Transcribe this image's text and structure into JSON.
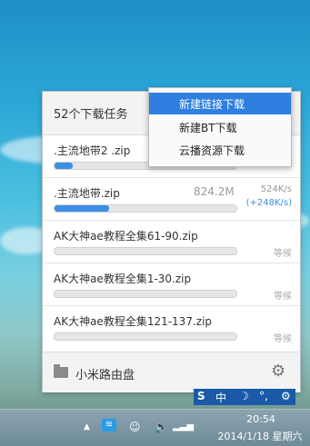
{
  "panel": {
    "title": "52个下载任务",
    "footer_label": "小米路由盘"
  },
  "menu": {
    "items": [
      {
        "label": "新建链接下载",
        "active": true
      },
      {
        "label": "新建BT下载",
        "active": false
      },
      {
        "label": "云播资源下载",
        "active": false
      }
    ]
  },
  "downloads": [
    {
      "name": ".主流地带2 .zip",
      "size": "",
      "speed": "",
      "speed_up": "",
      "status": "",
      "progress": 0.1
    },
    {
      "name": ".主流地带.zip",
      "size": "824.2M",
      "speed": "524K/s",
      "speed_up": "(+248K/s)",
      "status": "",
      "progress": 0.3
    },
    {
      "name": "AK大神ae教程全集61-90.zip",
      "size": "",
      "speed": "",
      "speed_up": "",
      "status": "等候",
      "progress": 0
    },
    {
      "name": "AK大神ae教程全集1-30.zip",
      "size": "",
      "speed": "",
      "speed_up": "",
      "status": "等候",
      "progress": 0
    },
    {
      "name": "AK大神ae教程全集121-137.zip",
      "size": "",
      "speed": "",
      "speed_up": "",
      "status": "等候",
      "progress": 0
    }
  ],
  "ime": {
    "lang": "中",
    "mode": "☽",
    "punct": "°,"
  },
  "taskbar": {
    "time": "20:54",
    "date": "2014/1/18 星期六"
  },
  "colors": {
    "accent": "#2f7fe0",
    "progress": "#3d8ee4"
  }
}
